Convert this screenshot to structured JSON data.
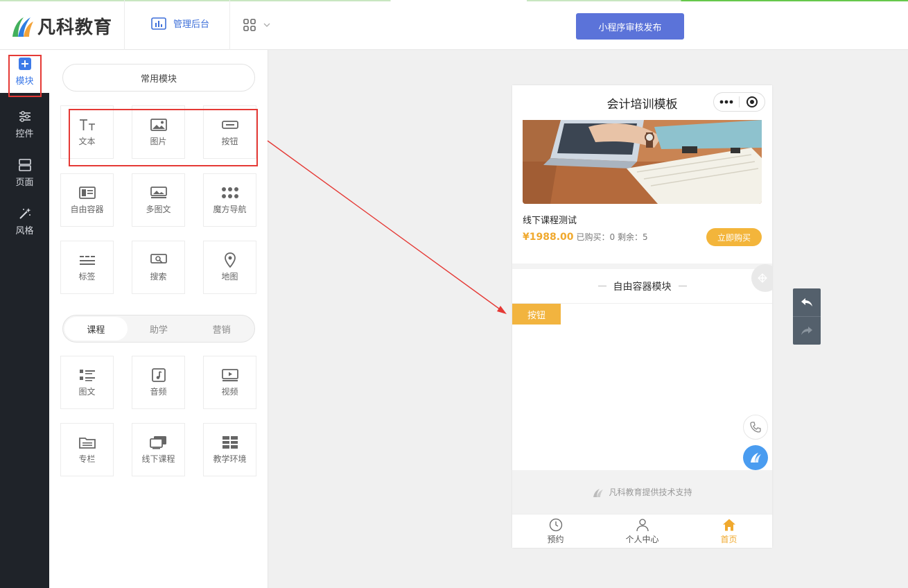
{
  "header": {
    "brand": "凡科教育",
    "admin_label": "管理后台",
    "publish_label": "小程序审核发布"
  },
  "sidebar": {
    "items": [
      {
        "label": "模块",
        "icon": "plus-square-icon",
        "active": true
      },
      {
        "label": "控件",
        "icon": "sliders-icon"
      },
      {
        "label": "页面",
        "icon": "page-layout-icon"
      },
      {
        "label": "风格",
        "icon": "magic-wand-icon"
      }
    ]
  },
  "modules": {
    "common_label": "常用模块",
    "common_tiles": [
      {
        "label": "文本",
        "icon": "text-icon"
      },
      {
        "label": "图片",
        "icon": "image-icon"
      },
      {
        "label": "按钮",
        "icon": "button-icon"
      },
      {
        "label": "自由容器",
        "icon": "free-container-icon"
      },
      {
        "label": "多图文",
        "icon": "multi-image-text-icon"
      },
      {
        "label": "魔方导航",
        "icon": "grid-dots-icon"
      },
      {
        "label": "标签",
        "icon": "tag-lines-icon"
      },
      {
        "label": "搜索",
        "icon": "search-icon"
      },
      {
        "label": "地图",
        "icon": "map-pin-icon"
      }
    ],
    "tabs": [
      {
        "label": "课程",
        "active": true
      },
      {
        "label": "助学"
      },
      {
        "label": "营销"
      }
    ],
    "course_tiles": [
      {
        "label": "图文",
        "icon": "list-icon"
      },
      {
        "label": "音频",
        "icon": "music-note-icon"
      },
      {
        "label": "视频",
        "icon": "video-play-icon"
      },
      {
        "label": "专栏",
        "icon": "folder-icon"
      },
      {
        "label": "线下课程",
        "icon": "offline-course-icon"
      },
      {
        "label": "教学环境",
        "icon": "classroom-grid-icon"
      }
    ]
  },
  "preview": {
    "page_title": "会计培训模板",
    "course": {
      "title": "线下课程测试",
      "price": "¥1988.00",
      "meta": "已购买：0 剩余：5",
      "buy_label": "立即购买"
    },
    "container_title": "自由容器模块",
    "dropped_button": "按钮",
    "support_text": "凡科教育提供技术支持",
    "tabbar": [
      {
        "label": "预约",
        "icon": "clock-icon"
      },
      {
        "label": "个人中心",
        "icon": "user-icon"
      },
      {
        "label": "首页",
        "icon": "home-icon",
        "active": true
      }
    ]
  },
  "colors": {
    "accent_blue": "#5b73d9",
    "highlight_red": "#e53935",
    "orange": "#f3b53b",
    "sidebar_dark": "#1f2329"
  }
}
